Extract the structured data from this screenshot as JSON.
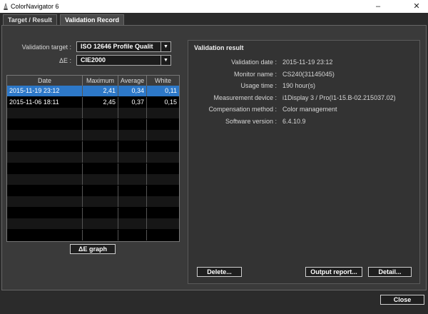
{
  "window": {
    "title": "ColorNavigator 6"
  },
  "tabs": [
    {
      "label": "Target / Result"
    },
    {
      "label": "Validation Record"
    }
  ],
  "form": {
    "validation_target_label": "Validation target :",
    "validation_target_value": "ISO 12646 Profile Qualit",
    "delta_e_label": "ΔE :",
    "delta_e_value": "CIE2000"
  },
  "grid": {
    "columns": [
      "Date",
      "Maximum",
      "Average",
      "White"
    ],
    "rows": [
      [
        "2015-11-19 23:12",
        "2,41",
        "0,34",
        "0,11"
      ],
      [
        "2015-11-06 18:11",
        "2,45",
        "0,37",
        "0,15"
      ]
    ]
  },
  "buttons": {
    "delta_e_graph": "ΔE graph",
    "delete": "Delete...",
    "output_report": "Output report...",
    "detail": "Detail...",
    "close": "Close"
  },
  "result": {
    "title": "Validation result",
    "items": [
      {
        "key": "Validation date :",
        "value": "2015-11-19 23:12"
      },
      {
        "key": "Monitor name :",
        "value": "CS240(31145045)"
      },
      {
        "key": "Usage time :",
        "value": "190 hour(s)"
      },
      {
        "key": "Measurement device :",
        "value": "i1Display 3 / Pro(I1-15.B-02.215037.02)"
      },
      {
        "key": "Compensation method :",
        "value": "Color management"
      },
      {
        "key": "Software version :",
        "value": "6.4.10.9"
      }
    ]
  }
}
